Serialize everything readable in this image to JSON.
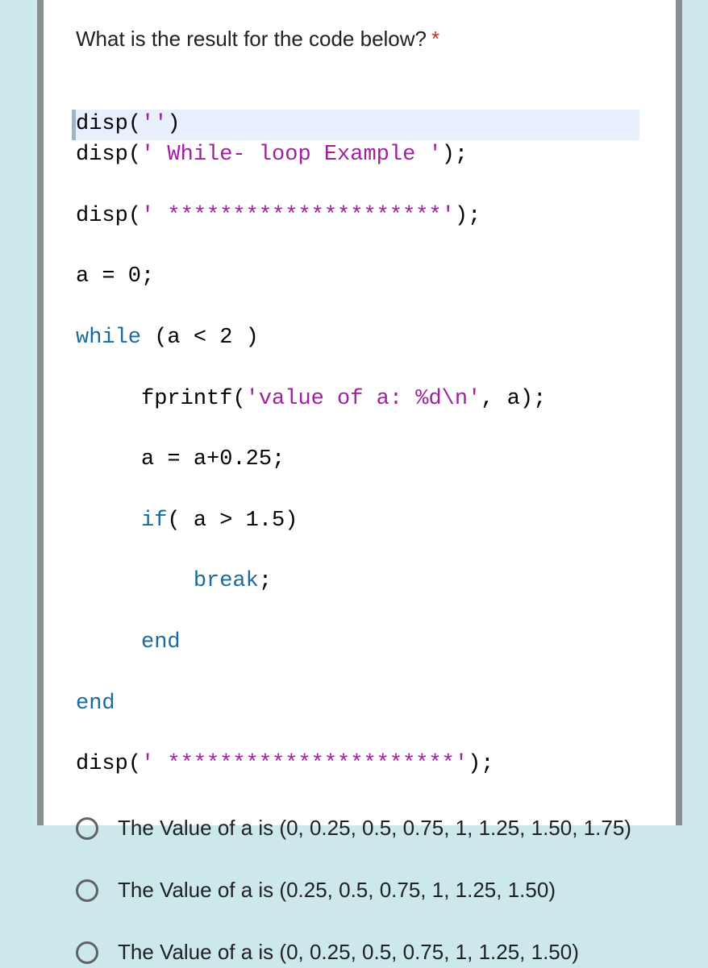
{
  "question": "What is the result for the code below?",
  "required_marker": "*",
  "code": {
    "line1_fn": "disp",
    "line1_open": "(",
    "line1_str": "''",
    "line1_close": ")",
    "line2_fn": "disp",
    "line2_open": "(",
    "line2_str": "' While- loop Example '",
    "line2_close": ");",
    "line3_fn": "disp",
    "line3_open": "(",
    "line3_str": "' *********************'",
    "line3_close": ");",
    "line4": "a = 0;",
    "line5a": "while",
    "line5b": " (a < 2 )",
    "line6_pad": "     ",
    "line6_fn": "fprintf",
    "line6_open": "(",
    "line6_str": "'value of a: %d\\n'",
    "line6_rest": ", a);",
    "line7": "     a = a+0.25;",
    "line8a": "     ",
    "line8_if": "if",
    "line8b": "( a > 1.5)",
    "line9a": "         ",
    "line9_kw": "break",
    "line9b": ";",
    "line10a": "     ",
    "line10_kw": "end",
    "line11_kw": "end",
    "line12_fn": "disp",
    "line12_open": "(",
    "line12_str": "' **********************'",
    "line12_close": ");"
  },
  "options": [
    "The Value of a is (0, 0.25, 0.5, 0.75, 1, 1.25, 1.50, 1.75)",
    "The Value of a is (0.25, 0.5, 0.75, 1, 1.25, 1.50)",
    "The Value of a is (0, 0.25, 0.5, 0.75, 1, 1.25, 1.50)"
  ]
}
